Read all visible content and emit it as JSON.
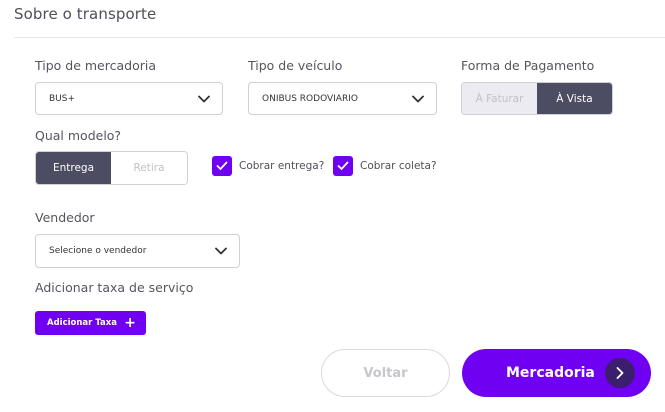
{
  "section": {
    "title": "Sobre o transporte"
  },
  "cargo_type": {
    "label": "Tipo de mercadoria",
    "value": "BUS+"
  },
  "vehicle_type": {
    "label": "Tipo de veículo",
    "value": "ONIBUS RODOVIARIO"
  },
  "payment": {
    "label": "Forma de Pagamento",
    "options": [
      "À Faturar",
      "À Vista"
    ],
    "selected": "À Vista"
  },
  "model": {
    "label": "Qual modelo?",
    "options": [
      "Entrega",
      "Retira"
    ],
    "selected": "Entrega"
  },
  "charges": [
    {
      "label": "Cobrar entrega?",
      "checked": true
    },
    {
      "label": "Cobrar coleta?",
      "checked": true
    }
  ],
  "seller": {
    "label": "Vendedor",
    "placeholder": "Selecione o vendedor"
  },
  "service_fee": {
    "label": "Adicionar taxa de serviço",
    "button_label": "Adicionar Taxa",
    "button_icon": "+"
  },
  "actions": {
    "back_label": "Voltar",
    "next_label": "Mercadoria"
  },
  "colors": {
    "accent": "#7000f2",
    "selected_segment": "#4c4c62",
    "next_icon_bg": "#3c1e6e"
  }
}
